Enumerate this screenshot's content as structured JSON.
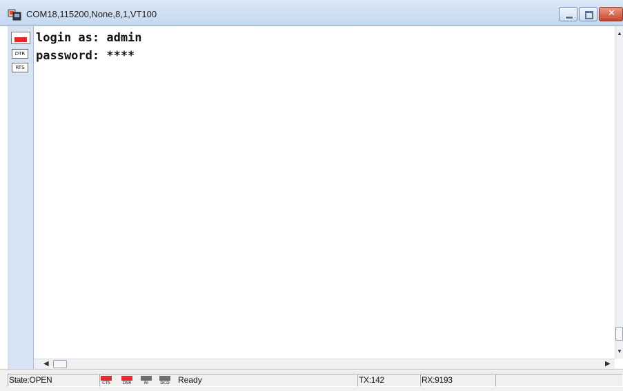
{
  "window": {
    "title": "COM18,115200,None,8,1,VT100",
    "close_glyph": "✕"
  },
  "toolbar": {
    "connection_icon": "connection-toggle-icon",
    "dtr_label": "DTR",
    "rts_label": "RTS"
  },
  "terminal": {
    "lines": [
      "login as: admin",
      "password: ****"
    ]
  },
  "scroll": {
    "up": "▲",
    "down": "▼",
    "left": "◀",
    "right": "▶"
  },
  "statusbar": {
    "state": "State:OPEN",
    "leds": [
      {
        "label": "CTS",
        "color": "#e8262b"
      },
      {
        "label": "DSR",
        "color": "#e8262b"
      },
      {
        "label": "RI",
        "color": "#6d6d6d"
      },
      {
        "label": "DCD",
        "color": "#6d6d6d"
      }
    ],
    "ready": "Ready",
    "tx": "TX:142",
    "rx": "RX:9193"
  }
}
